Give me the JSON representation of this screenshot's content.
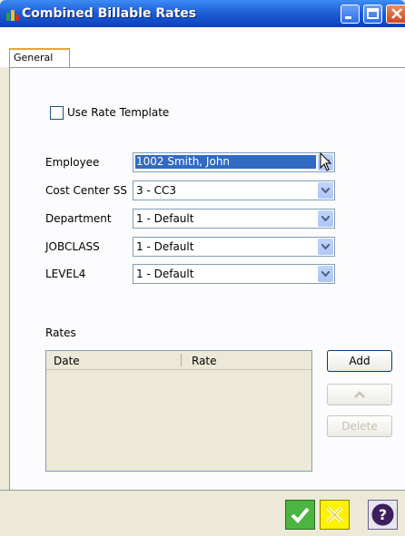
{
  "window": {
    "title": "Combined Billable Rates"
  },
  "tabs": [
    {
      "label": "General"
    }
  ],
  "form": {
    "use_rate_template": {
      "label": "Use Rate Template",
      "checked": false
    },
    "fields": [
      {
        "label": "Employee",
        "value": "1002 Smith, John"
      },
      {
        "label": "Cost Center SS",
        "value": "3 - CC3"
      },
      {
        "label": "Department",
        "value": "1 - Default"
      },
      {
        "label": "JOBCLASS",
        "value": "1 - Default"
      },
      {
        "label": "LEVEL4",
        "value": "1 - Default"
      }
    ]
  },
  "rates": {
    "label": "Rates",
    "columns": [
      "Date",
      "Rate"
    ],
    "rows": [],
    "buttons": {
      "add": "Add",
      "delete": "Delete"
    }
  },
  "colors": {
    "titlebar": "#1f5fd6",
    "selection": "#316ac5",
    "ok": "#4cb542",
    "cancel": "#fff200"
  },
  "icons": {
    "app": "app-icon",
    "minimize": "minimize-icon",
    "maximize": "maximize-icon",
    "close": "close-icon",
    "move_up": "chevron-up-icon",
    "ok": "checkmark-icon",
    "cancel": "x-icon",
    "help": "question-icon"
  }
}
